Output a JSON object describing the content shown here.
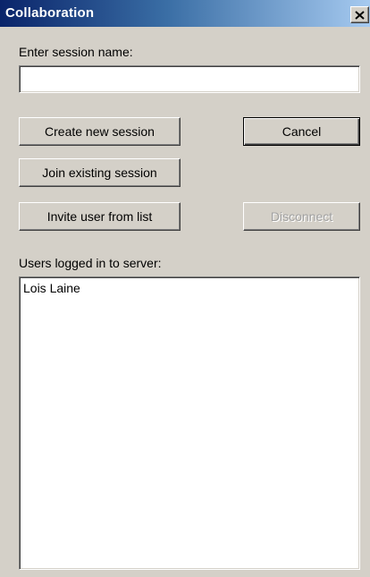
{
  "window": {
    "title": "Collaboration",
    "close_glyph": "✕"
  },
  "session": {
    "name_label": "Enter session name:",
    "name_value": "",
    "name_placeholder": ""
  },
  "buttons": {
    "create_label": "Create new session",
    "cancel_label": "Cancel",
    "join_label": "Join existing session",
    "invite_label": "Invite user from list",
    "disconnect_label": "Disconnect"
  },
  "users": {
    "label": "Users logged in to server:",
    "items": [
      {
        "name": "Lois Laine"
      }
    ]
  },
  "icons": {
    "close": "close-icon"
  },
  "colors": {
    "titlebar_start": "#0a246a",
    "titlebar_end": "#a6caf0",
    "dialog_face": "#d4d0c8",
    "disabled_text": "#a0a0a0"
  }
}
